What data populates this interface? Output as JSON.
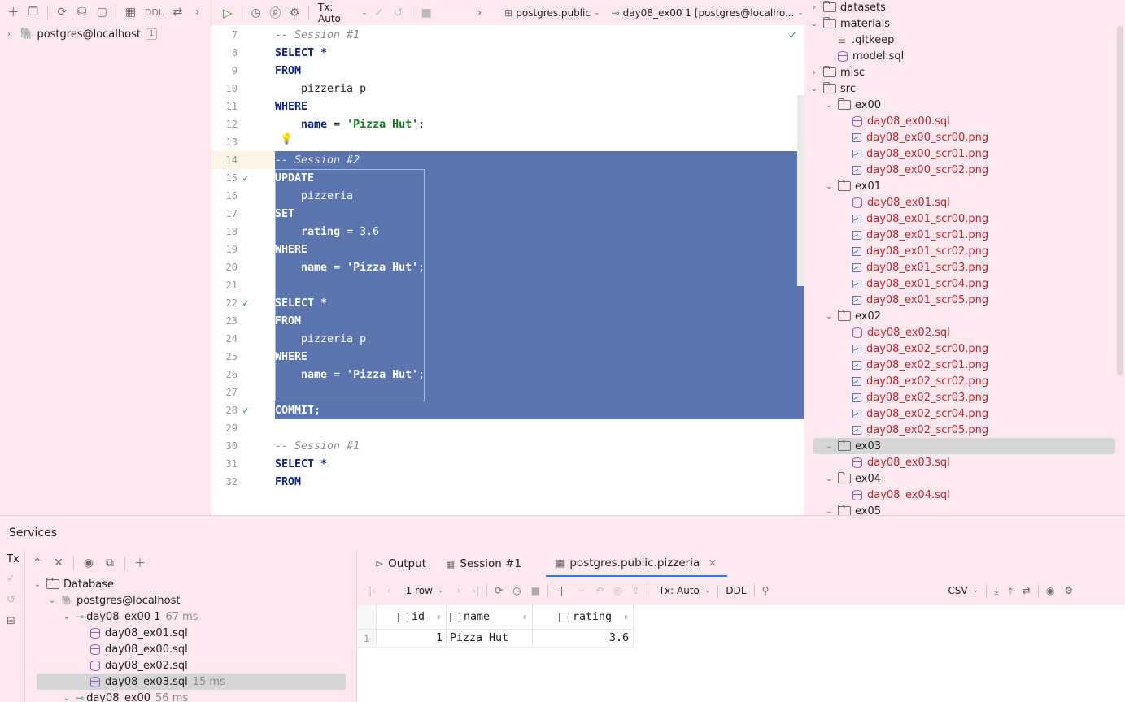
{
  "left_toolbar": {
    "ddl_label": "DDL"
  },
  "left_tree": {
    "root_label": "postgres@localhost",
    "root_badge": "1"
  },
  "editor_toolbar": {
    "tx_label": "Tx: Auto",
    "schema_label": "postgres.public",
    "session_label": "day08_ex00 1 [postgres@localho..."
  },
  "code_lines": [
    {
      "n": "7",
      "text": "-- Session #1",
      "type": "comment"
    },
    {
      "n": "8",
      "text": "SELECT *",
      "type": "kw"
    },
    {
      "n": "9",
      "text": "FROM",
      "type": "kw"
    },
    {
      "n": "10",
      "text": "    pizzeria p",
      "type": "plain"
    },
    {
      "n": "11",
      "text": "WHERE",
      "type": "kw"
    },
    {
      "n": "12",
      "pre": "    ",
      "a": "name",
      "b": " = ",
      "c": "'Pizza Hut'",
      "d": ";",
      "type": "where"
    },
    {
      "n": "13",
      "text": "",
      "type": "plain"
    },
    {
      "n": "14",
      "text": "-- Session #2",
      "type": "comment"
    },
    {
      "n": "15",
      "text": "UPDATE",
      "type": "kw"
    },
    {
      "n": "16",
      "text": "    pizzeria",
      "type": "plain"
    },
    {
      "n": "17",
      "text": "SET",
      "type": "kw"
    },
    {
      "n": "18",
      "pre": "    ",
      "a": "rating",
      "b": " = ",
      "c": "3.6",
      "d": "",
      "type": "set"
    },
    {
      "n": "19",
      "text": "WHERE",
      "type": "kw"
    },
    {
      "n": "20",
      "pre": "    ",
      "a": "name",
      "b": " = ",
      "c": "'Pizza Hut'",
      "d": ";",
      "type": "where"
    },
    {
      "n": "21",
      "text": "",
      "type": "plain"
    },
    {
      "n": "22",
      "text": "SELECT *",
      "type": "kw"
    },
    {
      "n": "23",
      "text": "FROM",
      "type": "kw"
    },
    {
      "n": "24",
      "text": "    pizzeria p",
      "type": "plain"
    },
    {
      "n": "25",
      "text": "WHERE",
      "type": "kw"
    },
    {
      "n": "26",
      "pre": "    ",
      "a": "name",
      "b": " = ",
      "c": "'Pizza Hut'",
      "d": ";",
      "type": "where"
    },
    {
      "n": "27",
      "text": "",
      "type": "plain"
    },
    {
      "n": "28",
      "text": "COMMIT;",
      "type": "kw"
    },
    {
      "n": "29",
      "text": "",
      "type": "plain"
    },
    {
      "n": "30",
      "text": "-- Session #1",
      "type": "comment"
    },
    {
      "n": "31",
      "text": "SELECT *",
      "type": "kw"
    },
    {
      "n": "32",
      "text": "FROM",
      "type": "kw"
    }
  ],
  "right_tree": [
    {
      "label": "datasets",
      "kind": "folder",
      "chev": ">",
      "indent": 0
    },
    {
      "label": "materials",
      "kind": "folder",
      "chev": "v",
      "indent": 0
    },
    {
      "label": ".gitkeep",
      "kind": "file",
      "indent": 1
    },
    {
      "label": "model.sql",
      "kind": "db",
      "indent": 1
    },
    {
      "label": "misc",
      "kind": "folder",
      "chev": ">",
      "indent": 0
    },
    {
      "label": "src",
      "kind": "folder",
      "chev": "v",
      "indent": 0
    },
    {
      "label": "ex00",
      "kind": "folder",
      "chev": "v",
      "indent": 1
    },
    {
      "label": "day08_ex00.sql",
      "kind": "db",
      "indent": 2,
      "red": true
    },
    {
      "label": "day08_ex00_scr00.png",
      "kind": "img",
      "indent": 2,
      "red": true
    },
    {
      "label": "day08_ex00_scr01.png",
      "kind": "img",
      "indent": 2,
      "red": true
    },
    {
      "label": "day08_ex00_scr02.png",
      "kind": "img",
      "indent": 2,
      "red": true
    },
    {
      "label": "ex01",
      "kind": "folder",
      "chev": "v",
      "indent": 1
    },
    {
      "label": "day08_ex01.sql",
      "kind": "db",
      "indent": 2,
      "red": true
    },
    {
      "label": "day08_ex01_scr00.png",
      "kind": "img",
      "indent": 2,
      "red": true
    },
    {
      "label": "day08_ex01_scr01.png",
      "kind": "img",
      "indent": 2,
      "red": true
    },
    {
      "label": "day08_ex01_scr02.png",
      "kind": "img",
      "indent": 2,
      "red": true
    },
    {
      "label": "day08_ex01_scr03.png",
      "kind": "img",
      "indent": 2,
      "red": true
    },
    {
      "label": "day08_ex01_scr04.png",
      "kind": "img",
      "indent": 2,
      "red": true
    },
    {
      "label": "day08_ex01_scr05.png",
      "kind": "img",
      "indent": 2,
      "red": true
    },
    {
      "label": "ex02",
      "kind": "folder",
      "chev": "v",
      "indent": 1
    },
    {
      "label": "day08_ex02.sql",
      "kind": "db",
      "indent": 2,
      "red": true
    },
    {
      "label": "day08_ex02_scr00.png",
      "kind": "img",
      "indent": 2,
      "red": true
    },
    {
      "label": "day08_ex02_scr01.png",
      "kind": "img",
      "indent": 2,
      "red": true
    },
    {
      "label": "day08_ex02_scr02.png",
      "kind": "img",
      "indent": 2,
      "red": true
    },
    {
      "label": "day08_ex02_scr03.png",
      "kind": "img",
      "indent": 2,
      "red": true
    },
    {
      "label": "day08_ex02_scr04.png",
      "kind": "img",
      "indent": 2,
      "red": true
    },
    {
      "label": "day08_ex02_scr05.png",
      "kind": "img",
      "indent": 2,
      "red": true
    },
    {
      "label": "ex03",
      "kind": "folder",
      "chev": "v",
      "indent": 1,
      "selected": true
    },
    {
      "label": "day08_ex03.sql",
      "kind": "db",
      "indent": 2,
      "red": true
    },
    {
      "label": "ex04",
      "kind": "folder",
      "chev": "v",
      "indent": 1
    },
    {
      "label": "day08_ex04.sql",
      "kind": "db",
      "indent": 2,
      "red": true
    },
    {
      "label": "ex05",
      "kind": "folder",
      "chev": "v",
      "indent": 1
    }
  ],
  "services": {
    "title": "Services",
    "tx_short": "Tx",
    "tree": [
      {
        "label": "Database",
        "kind": "folder",
        "chev": "v",
        "indent": 0
      },
      {
        "label": "postgres@localhost",
        "kind": "pg",
        "chev": "v",
        "indent": 1
      },
      {
        "label": "day08_ex00 1",
        "kind": "session",
        "chev": "v",
        "indent": 2,
        "meta": "67 ms"
      },
      {
        "label": "day08_ex01.sql",
        "kind": "db",
        "indent": 3
      },
      {
        "label": "day08_ex00.sql",
        "kind": "db",
        "indent": 3
      },
      {
        "label": "day08_ex02.sql",
        "kind": "db",
        "indent": 3
      },
      {
        "label": "day08_ex03.sql",
        "kind": "db",
        "indent": 3,
        "meta": "15 ms",
        "selected": true
      },
      {
        "label": "day08_ex00",
        "kind": "session",
        "chev": "v",
        "indent": 2,
        "meta": "56 ms"
      }
    ],
    "tabs": [
      {
        "label": "Output",
        "icon": "console-icon"
      },
      {
        "label": "Session #1",
        "icon": "table-icon"
      },
      {
        "label": "postgres.public.pizzeria",
        "icon": "table-icon",
        "active": true,
        "closable": true
      }
    ],
    "grid_toolbar": {
      "rows_label": "1 row",
      "tx_label": "Tx: Auto",
      "ddl_label": "DDL",
      "format_label": "CSV"
    },
    "columns": [
      "id",
      "name",
      "rating"
    ],
    "rows": [
      {
        "rownum": "1",
        "id": "1",
        "name": "Pizza Hut",
        "rating": "3.6"
      }
    ]
  }
}
